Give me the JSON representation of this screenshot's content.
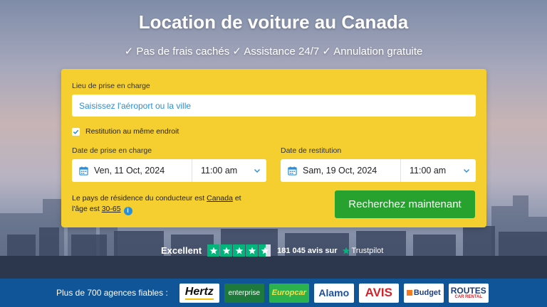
{
  "hero": {
    "title": "Location de voiture au Canada",
    "subtitle": "✓ Pas de frais cachés ✓ Assistance 24/7 ✓ Annulation gratuite"
  },
  "search": {
    "pickup_label": "Lieu de prise en charge",
    "pickup_placeholder": "Saisissez l'aéroport ou la ville",
    "same_return_label": "Restitution au même endroit",
    "same_return_checked": true,
    "pickup_date_label": "Date de prise en charge",
    "pickup_date": "Ven, 11 Oct, 2024",
    "pickup_time": "11:00 am",
    "return_date_label": "Date de restitution",
    "return_date": "Sam, 19 Oct, 2024",
    "return_time": "11:00 am",
    "residence_prefix": "Le pays de résidence du conducteur est",
    "residence_country": "Canada",
    "residence_mid": "et l'âge est",
    "age_range": "30-65",
    "search_button": "Recherchez maintenant"
  },
  "trustpilot": {
    "rating_word": "Excellent",
    "review_count": "181 045 avis sur",
    "brand": "Trustpilot",
    "stars": 4.5,
    "color": "#00b67a"
  },
  "partners": {
    "label": "Plus de 700 agences fiables :",
    "logos": [
      {
        "name": "Hertz",
        "bg": "#ffffff",
        "fg": "#111111"
      },
      {
        "name": "enterprise",
        "bg": "#1e7a3c",
        "fg": "#ffffff"
      },
      {
        "name": "Europcar",
        "bg": "#2bb24c",
        "fg": "#f7e14b"
      },
      {
        "name": "Alamo",
        "bg": "#ffffff",
        "fg": "#1a4fa0"
      },
      {
        "name": "AVIS",
        "bg": "#ffffff",
        "fg": "#d2232a"
      },
      {
        "name": "Budget",
        "bg": "#ffffff",
        "fg": "#1c3f7a"
      },
      {
        "name": "ROUTES",
        "bg": "#ffffff",
        "fg": "#1c3f7a",
        "tag": "CAR RENTAL"
      }
    ]
  },
  "colors": {
    "card_bg": "#f5cf2f",
    "accent_blue": "#2a8fd8",
    "button_green": "#27a22f",
    "footer_blue": "#0f5598"
  }
}
